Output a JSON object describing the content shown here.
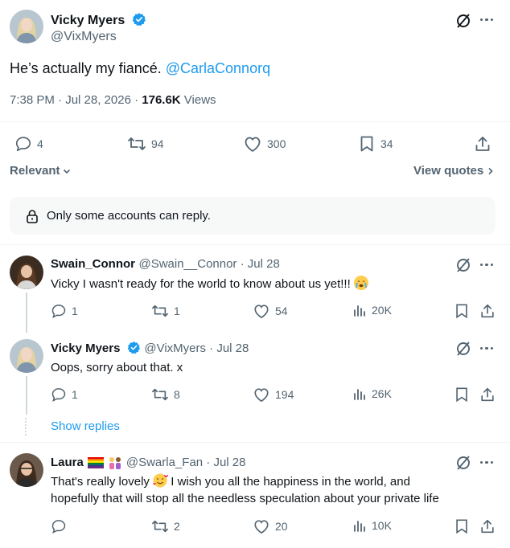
{
  "tweet": {
    "author_name": "Vicky Myers",
    "author_handle": "@VixMyers",
    "text_prefix": "He’s actually my fiancé. ",
    "mention": "@CarlaConnorq",
    "time": "7:38 PM · Jul 28, 2026 · ",
    "views_count": "176.6K",
    "views_label": " Views",
    "stats": {
      "replies": "4",
      "reposts": "94",
      "likes": "300",
      "bookmarks": "34"
    }
  },
  "sort": {
    "label": "Relevant",
    "view_quotes": "View quotes"
  },
  "reply_restriction": "Only some accounts can reply.",
  "colors": {
    "link": "#1d9bf0",
    "verified": "#1d9bf0",
    "muted": "#536471"
  },
  "replies": [
    {
      "name": "Swain_Connor",
      "meta": "@Swain__Connor · Jul 28",
      "text": "Vicky I wasn't ready for the world to know about us yet!!!",
      "emoji": "crying-face",
      "stats": {
        "replies": "1",
        "reposts": "1",
        "likes": "54",
        "views": "20K"
      }
    },
    {
      "name": "Vicky Myers",
      "meta": "@VixMyers · Jul 28",
      "text": "Oops, sorry about that. x",
      "stats": {
        "replies": "1",
        "reposts": "8",
        "likes": "194",
        "views": "26K"
      }
    },
    {
      "name": "Laura",
      "meta": "@Swarla_Fan · Jul 28",
      "text_line1": "That's really lovely",
      "text_line1_rest": "I wish you all the happiness in the world, and",
      "text_line2": "hopefully that will stop all the needless speculation about your private life",
      "emoji": "smiling-face-with-hearts",
      "stats": {
        "replies": "",
        "reposts": "2",
        "likes": "20",
        "views": "10K"
      }
    }
  ],
  "show_replies": "Show replies"
}
